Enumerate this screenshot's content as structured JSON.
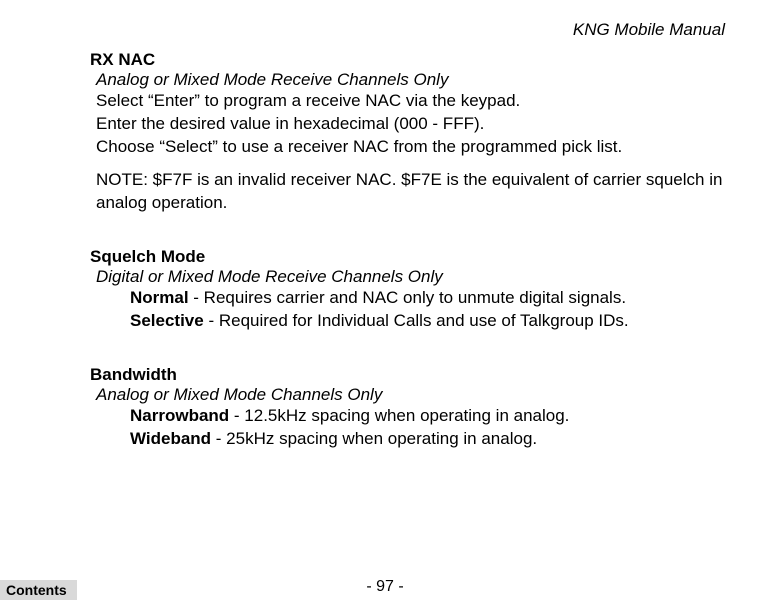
{
  "header": {
    "title": "KNG Mobile Manual"
  },
  "sections": {
    "rxnac": {
      "heading": "RX NAC",
      "subtitle": "Analog or Mixed Mode Receive Channels Only",
      "line1": "Select “Enter” to program a receive NAC via the keypad.",
      "line2": "Enter the desired value in hexadecimal (000 - FFF).",
      "line3": "Choose “Select” to use a receiver NAC from the programmed pick list.",
      "note": "NOTE: $F7F is an invalid receiver NAC. $F7E is the equivalent of carrier squelch in analog operation."
    },
    "squelch": {
      "heading": "Squelch Mode",
      "subtitle": "Digital or Mixed Mode Receive Channels Only",
      "options": {
        "normal": {
          "name": "Normal",
          "desc": " - Requires carrier and NAC only to unmute digital signals."
        },
        "selective": {
          "name": "Selective",
          "desc": " - Required for Individual Calls and use of Talkgroup IDs."
        }
      }
    },
    "bandwidth": {
      "heading": "Bandwidth",
      "subtitle": "Analog or Mixed Mode Channels Only",
      "options": {
        "narrowband": {
          "name": "Narrowband",
          "desc": " - 12.5kHz spacing when operating in analog."
        },
        "wideband": {
          "name": "Wideband",
          "desc": " - 25kHz spacing when operating in analog."
        }
      }
    }
  },
  "footer": {
    "pageNumber": "- 97 -",
    "contents": "Contents"
  }
}
